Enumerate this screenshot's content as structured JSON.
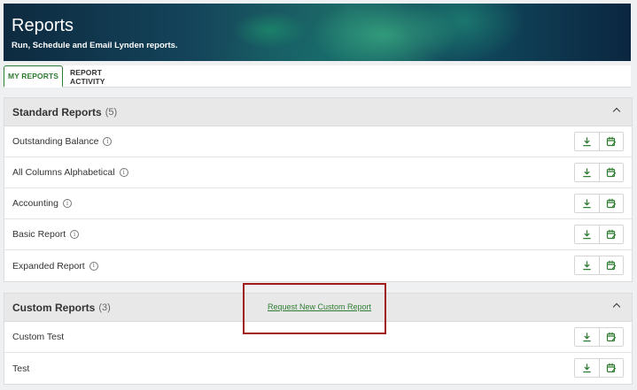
{
  "banner": {
    "title": "Reports",
    "subtitle": "Run, Schedule and Email Lynden reports."
  },
  "tabs": [
    {
      "label": "MY REPORTS",
      "active": true
    },
    {
      "label": "REPORT ACTIVITY",
      "active": false
    }
  ],
  "standard": {
    "title": "Standard Reports",
    "count": "(5)",
    "items": [
      {
        "label": "Outstanding Balance",
        "info": true
      },
      {
        "label": "All Columns Alphabetical",
        "info": true
      },
      {
        "label": "Accounting",
        "info": true
      },
      {
        "label": "Basic Report",
        "info": true
      },
      {
        "label": "Expanded Report",
        "info": true
      }
    ]
  },
  "custom": {
    "title": "Custom Reports",
    "count": "(3)",
    "request_link": "Request New Custom Report",
    "items": [
      {
        "label": "Custom Test"
      },
      {
        "label": "Test"
      }
    ]
  },
  "colors": {
    "accent": "#2e7d32",
    "highlight": "#a01a1a"
  },
  "icons": {
    "download": "download-icon",
    "schedule": "calendar-edit-icon",
    "info": "info-icon",
    "collapse": "chevron-up-icon"
  }
}
